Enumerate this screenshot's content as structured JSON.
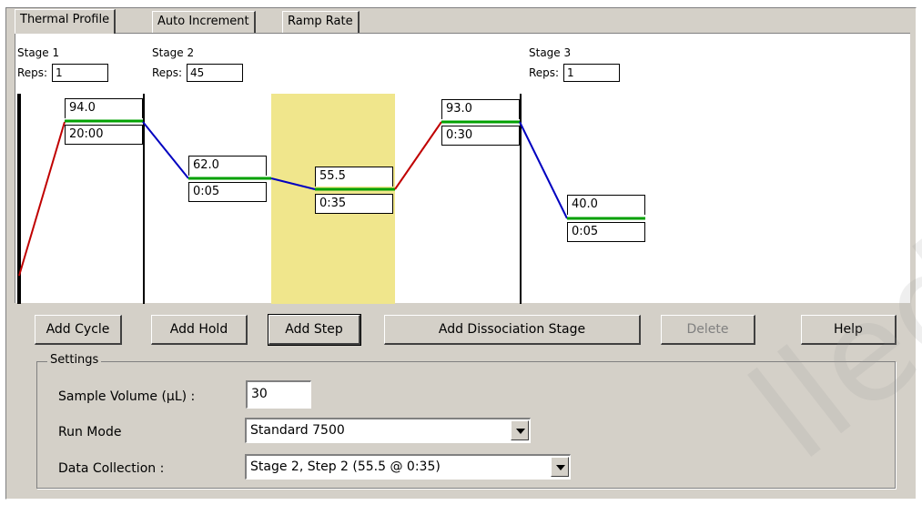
{
  "tabs": [
    {
      "label": "Thermal Profile",
      "active": true
    },
    {
      "label": "Auto Increment",
      "active": false
    },
    {
      "label": "Ramp Rate",
      "active": false
    }
  ],
  "stages": [
    {
      "title": "Stage 1",
      "reps_label": "Reps:",
      "reps": "1"
    },
    {
      "title": "Stage 2",
      "reps_label": "Reps:",
      "reps": "45"
    },
    {
      "title": "Stage 3",
      "reps_label": "Reps:",
      "reps": "1"
    }
  ],
  "steps": [
    {
      "temp": "94.0",
      "time": "20:00"
    },
    {
      "temp": "62.0",
      "time": "0:05"
    },
    {
      "temp": "55.5",
      "time": "0:35"
    },
    {
      "temp": "93.0",
      "time": "0:30"
    },
    {
      "temp": "40.0",
      "time": "0:05"
    }
  ],
  "buttons": {
    "add_cycle": "Add Cycle",
    "add_hold": "Add Hold",
    "add_step": "Add Step",
    "add_dissociation": "Add Dissociation Stage",
    "delete": "Delete",
    "help": "Help"
  },
  "settings": {
    "group_title": "Settings",
    "sample_volume_label": "Sample Volume (µL) :",
    "sample_volume": "30",
    "run_mode_label": "Run Mode",
    "run_mode": "Standard 7500",
    "data_collection_label": "Data Collection :",
    "data_collection": "Stage 2, Step 2 (55.5 @ 0:35)"
  },
  "colors": {
    "ramp_up": "#c00000",
    "ramp_down": "#0000c0",
    "hold_line": "#00a000",
    "highlight": "#f0e68c"
  },
  "watermark": "lled"
}
